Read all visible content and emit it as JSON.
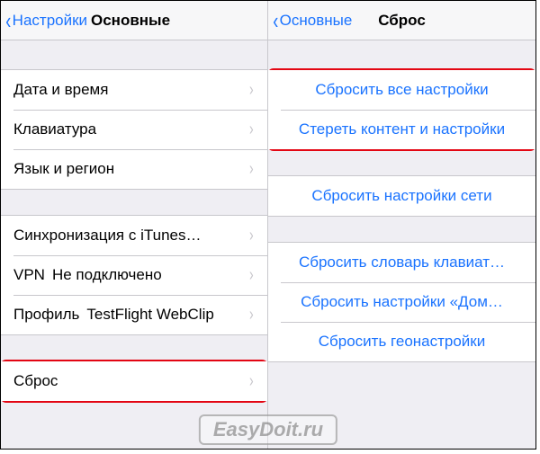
{
  "left": {
    "nav": {
      "back": "Настройки",
      "title": "Основные"
    },
    "group1": [
      {
        "label": "Дата и время"
      },
      {
        "label": "Клавиатура"
      },
      {
        "label": "Язык и регион"
      }
    ],
    "group2": [
      {
        "label": "Синхронизация с iTunes…",
        "value": ""
      },
      {
        "label": "VPN",
        "value": "Не подключено"
      },
      {
        "label": "Профиль",
        "value": "TestFlight WebClip"
      }
    ],
    "group3": [
      {
        "label": "Сброс"
      }
    ]
  },
  "right": {
    "nav": {
      "back": "Основные",
      "title": "Сброс"
    },
    "group1": [
      {
        "label": "Сбросить все настройки"
      },
      {
        "label": "Стереть контент и настройки"
      }
    ],
    "group2": [
      {
        "label": "Сбросить настройки сети"
      }
    ],
    "group3": [
      {
        "label": "Сбросить словарь клавиат…"
      },
      {
        "label": "Сбросить настройки «Дом…"
      },
      {
        "label": "Сбросить геонастройки"
      }
    ]
  },
  "watermark": "EasyDoit.ru"
}
